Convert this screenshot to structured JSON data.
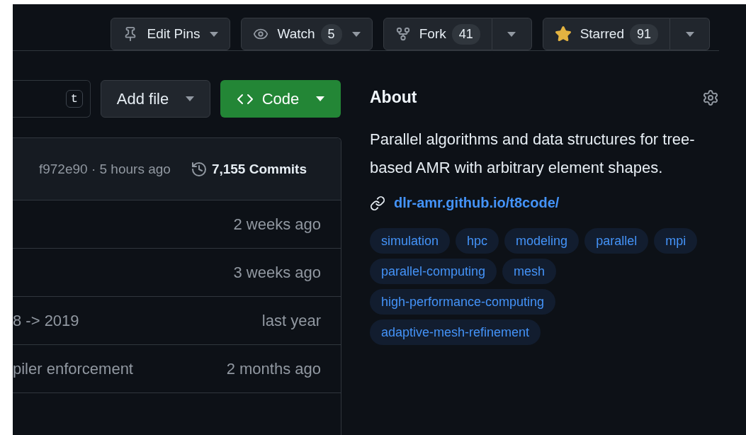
{
  "header_buttons": [
    {
      "kind": "pin",
      "label": "Edit Pins",
      "split": false
    },
    {
      "kind": "watch",
      "label": "Watch",
      "count": "5",
      "split": false
    },
    {
      "kind": "fork",
      "label": "Fork",
      "count": "41",
      "split": true
    },
    {
      "kind": "star",
      "label": "Starred",
      "count": "91",
      "split": true,
      "starred": true
    }
  ],
  "file_toolbar": {
    "shortcut": "t",
    "add_file": "Add file",
    "code": "Code"
  },
  "latest_commit": {
    "hash_time": "f972e90 · 5 hours ago",
    "commits": "7,155 Commits"
  },
  "file_rows": [
    {
      "time": "2 weeks ago"
    },
    {
      "time": "3 weeks ago"
    },
    {
      "message": "8 -> 2019",
      "time": "last year"
    },
    {
      "message": "piler enforcement",
      "time": "2 months ago"
    }
  ],
  "about": {
    "title": "About",
    "description": "Parallel algorithms and data structures for tree-based AMR with arbitrary element shapes.",
    "website": "dlr-amr.github.io/t8code/",
    "topics": [
      "simulation",
      "hpc",
      "modeling",
      "parallel",
      "mpi",
      "parallel-computing",
      "mesh",
      "high-performance-computing",
      "adaptive-mesh-refinement"
    ]
  }
}
